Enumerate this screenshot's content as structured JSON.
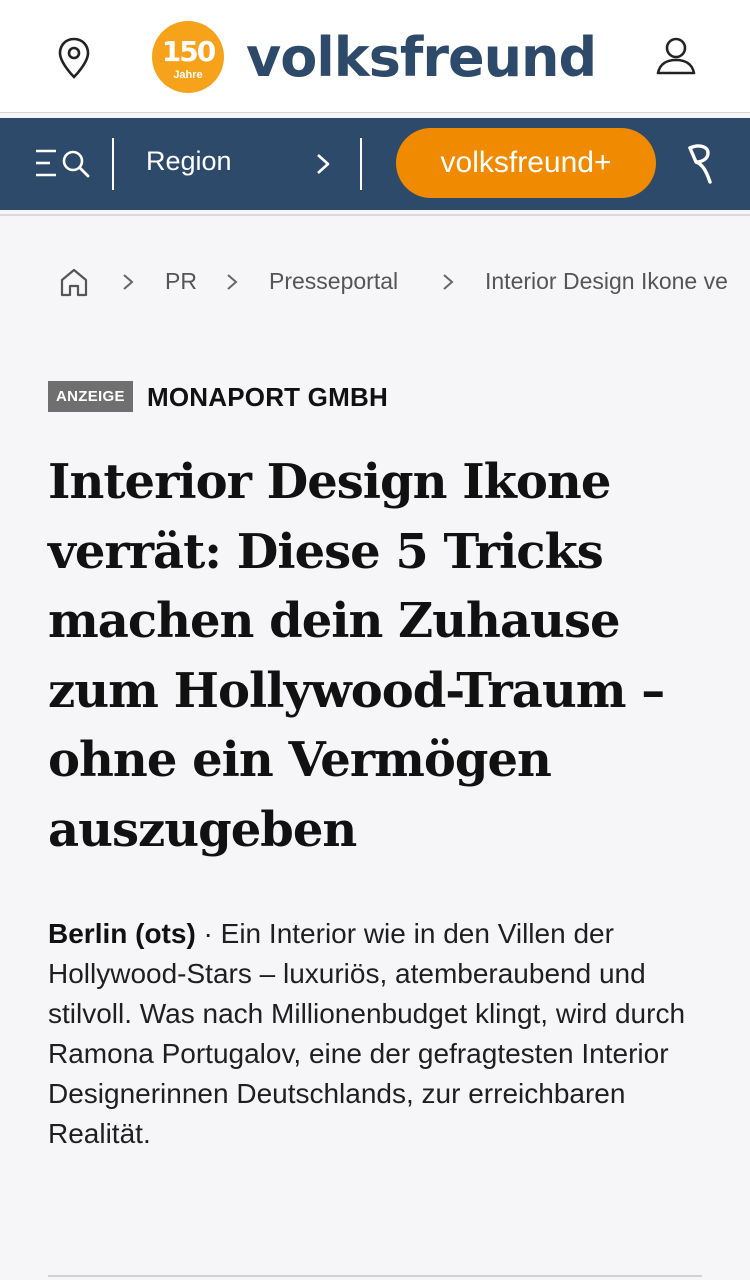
{
  "header": {
    "logo_badge_number": "150",
    "logo_badge_caption": "Jahre",
    "brand": "volksfreund",
    "location_icon": "map-pin-icon",
    "user_icon": "user-icon"
  },
  "nav": {
    "menu_icon": "menu-search-icon",
    "region_label": "Region",
    "plus_button": "volksfreund+",
    "app_icon": "r-logo-icon"
  },
  "breadcrumb": {
    "items": [
      "PR",
      "Presseportal",
      "Interior Design Ikone ve"
    ]
  },
  "article": {
    "badge": "ANZEIGE",
    "company": "MONAPORT GMBH",
    "headline_lines": [
      "Interior Design Ikone",
      "verrät: Diese 5 Tricks",
      "machen dein Zuhause",
      "zum Hollywood-Traum –",
      "ohne ein Vermögen",
      "auszugeben"
    ],
    "dateline": "Berlin (ots)",
    "lead_text": " · Ein Interior wie in den Villen der Hollywood-Stars – luxuriös, atemberaubend und stilvoll. Was nach Millionenbudget klingt, wird durch Ramona Portugalov, eine der gefragtesten Interior Designerinnen Deutschlands, zur erreichbaren Realität."
  },
  "colors": {
    "brand_blue": "#2e4a6b",
    "brand_orange": "#f08a00",
    "badge_orange": "#f7a21b"
  }
}
